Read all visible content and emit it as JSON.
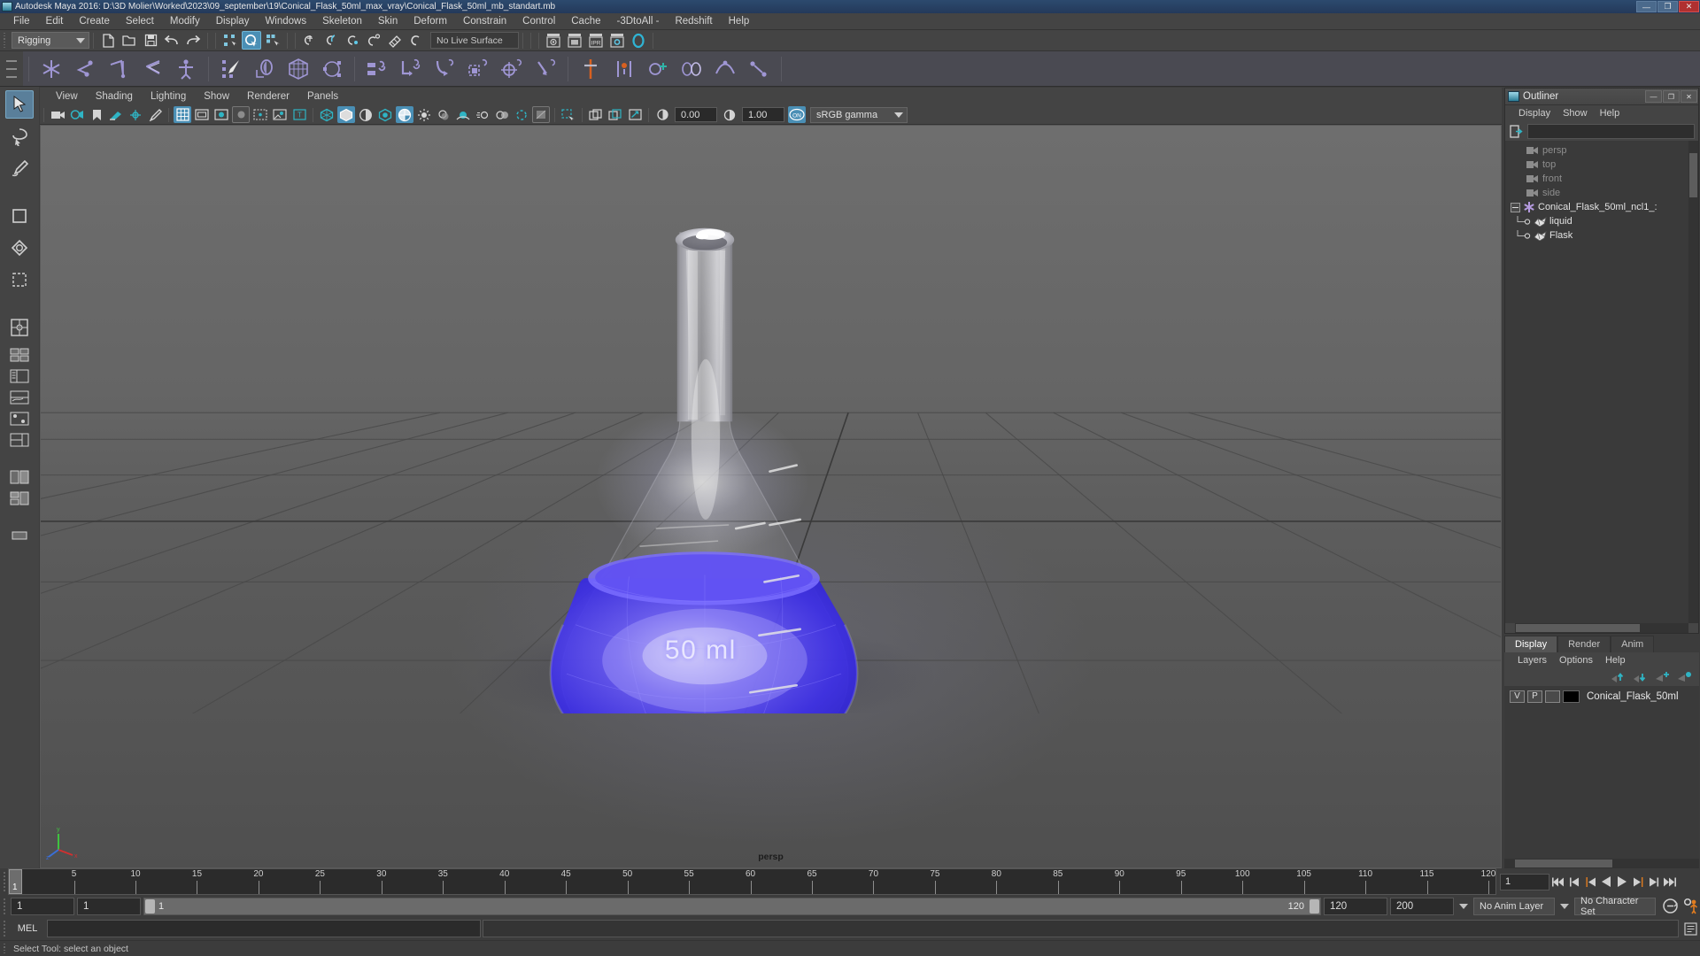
{
  "window": {
    "title": "Autodesk Maya 2016: D:\\3D Molier\\Worked\\2023\\09_september\\19\\Conical_Flask_50ml_max_vray\\Conical_Flask_50ml_mb_standart.mb",
    "minimize": "—",
    "maximize": "❐",
    "close": "✕",
    "icon": "maya-app-icon"
  },
  "menubar": {
    "items": [
      {
        "label": "File"
      },
      {
        "label": "Edit"
      },
      {
        "label": "Create"
      },
      {
        "label": "Select"
      },
      {
        "label": "Modify"
      },
      {
        "label": "Display"
      },
      {
        "label": "Windows"
      },
      {
        "label": "Skeleton"
      },
      {
        "label": "Skin"
      },
      {
        "label": "Deform"
      },
      {
        "label": "Constrain"
      },
      {
        "label": "Control"
      },
      {
        "label": "Cache"
      },
      {
        "label": "-3DtoAll -"
      },
      {
        "label": "Redshift"
      },
      {
        "label": "Help"
      }
    ]
  },
  "statusline": {
    "menuset": "Rigging",
    "live_surface": "No Live Surface",
    "icons": [
      "new-scene-icon",
      "open-scene-icon",
      "save-scene-icon",
      "undo-icon",
      "redo-icon",
      "select-by-hierarchy-icon",
      "select-by-object-icon",
      "select-by-component-icon",
      "snap-to-grid-icon",
      "snap-to-curve-icon",
      "snap-to-point-icon",
      "snap-to-projected-center-icon",
      "snap-to-view-plane-icon",
      "make-live-icon",
      "render-current-frame-icon",
      "irender-region-icon",
      "ipr-render-icon",
      "render-settings-icon",
      "hypershade-icon"
    ]
  },
  "shelf": {
    "tab": "Rigging",
    "icons": [
      "create-joint-icon",
      "insert-joint-icon",
      "mirror-joint-icon",
      "ik-handle-icon",
      "quick-rig-icon",
      "paint-skin-weights-icon",
      "bind-skin-icon",
      "lattice-deformer-icon",
      "cluster-deformer-icon",
      "parent-constraint-icon",
      "point-constraint-icon",
      "orient-constraint-icon",
      "scale-constraint-icon",
      "aim-constraint-icon",
      "pole-vector-constraint-icon",
      "set-driven-key-icon",
      "character-set-icon",
      "add-to-character-set-icon",
      "blend-shape-icon",
      "create-deformer-icon",
      "connect-joint-icon"
    ]
  },
  "toolbox": {
    "tools": [
      {
        "name": "select-tool",
        "active": true
      },
      {
        "name": "lasso-select-tool",
        "active": false
      },
      {
        "name": "paint-select-tool",
        "active": false
      },
      {
        "name": "move-tool",
        "active": false
      },
      {
        "name": "rotate-tool",
        "active": false
      },
      {
        "name": "scale-tool",
        "active": false
      }
    ],
    "layouts": [
      "single-perspective-layout",
      "four-view-layout",
      "outliner-persp-layout",
      "persp-graph-layout",
      "hypershade-persp-layout",
      "persp-outliner-layout",
      "two-pane-side-layout",
      "three-pane-split-layout",
      "last-layout"
    ]
  },
  "viewport": {
    "menu": [
      {
        "label": "View"
      },
      {
        "label": "Shading"
      },
      {
        "label": "Lighting"
      },
      {
        "label": "Show"
      },
      {
        "label": "Renderer"
      },
      {
        "label": "Panels"
      }
    ],
    "toolbar_icons": [
      "select-camera-icon",
      "camera-attributes-icon",
      "bookmark-icon",
      "image-plane-icon",
      "2d-pan-zoom-icon",
      "grease-pencil-icon",
      "grid-toggle-icon",
      "film-gate-icon",
      "resolution-gate-icon",
      "gate-mask-icon",
      "film-origin-icon",
      "exposure-icon",
      "xray-icon",
      "wireframe-shading-icon",
      "smooth-shading-icon",
      "smooth-shade-all-icon",
      "shaded-wireframe-icon",
      "textured-icon",
      "lighting-icon",
      "shadows-icon",
      "screen-space-ao-icon",
      "motion-blur-icon",
      "multisample-icon",
      "isolate-select-icon",
      "xray-joints-icon",
      "xray-active-components-icon",
      "exposure-reset-icon"
    ],
    "exposure": "0.00",
    "gamma": "1.00",
    "color_management_on": "ON",
    "view_transform": "sRGB gamma",
    "camera_label": "persp",
    "object_label": "50 ml"
  },
  "outliner": {
    "title": "Outliner",
    "icon": "outliner-window-icon",
    "menu": [
      {
        "label": "Display"
      },
      {
        "label": "Show"
      },
      {
        "label": "Help"
      }
    ],
    "search_placeholder": "",
    "search_value": "",
    "items": [
      {
        "label": "persp",
        "type": "camera",
        "dim": true,
        "indent": 1
      },
      {
        "label": "top",
        "type": "camera",
        "dim": true,
        "indent": 1
      },
      {
        "label": "front",
        "type": "camera",
        "dim": true,
        "indent": 1
      },
      {
        "label": "side",
        "type": "camera",
        "dim": true,
        "indent": 1
      },
      {
        "label": "Conical_Flask_50ml_ncl1_:",
        "type": "group",
        "dim": false,
        "indent": 0
      },
      {
        "label": "liquid",
        "type": "mesh",
        "dim": false,
        "indent": 2
      },
      {
        "label": "Flask",
        "type": "mesh",
        "dim": false,
        "indent": 2
      }
    ]
  },
  "layer_editor": {
    "tabs": [
      {
        "label": "Display",
        "active": true
      },
      {
        "label": "Render",
        "active": false
      },
      {
        "label": "Anim",
        "active": false
      }
    ],
    "menu": [
      {
        "label": "Layers"
      },
      {
        "label": "Options"
      },
      {
        "label": "Help"
      }
    ],
    "buttons": [
      "move-layer-up-icon",
      "move-layer-down-icon",
      "new-layer-icon",
      "new-layer-from-selected-icon"
    ],
    "layers": [
      {
        "visibility": "V",
        "playback": "P",
        "state": "",
        "color": "#000000",
        "name": "Conical_Flask_50ml"
      }
    ]
  },
  "timeline": {
    "start": 1,
    "end": 120,
    "current": "1",
    "tick_labels": [
      "5",
      "10",
      "15",
      "20",
      "25",
      "30",
      "35",
      "40",
      "45",
      "50",
      "55",
      "60",
      "65",
      "70",
      "75",
      "80",
      "85",
      "90",
      "95",
      "100",
      "105",
      "110",
      "115",
      "120"
    ],
    "playback_buttons": [
      "go-to-start-icon",
      "step-back-keyframe-icon",
      "step-back-frame-icon",
      "play-backwards-icon",
      "play-forwards-icon",
      "step-forward-frame-icon",
      "step-forward-keyframe-icon",
      "go-to-end-icon"
    ]
  },
  "rangeslider": {
    "anim_start": "1",
    "playback_start": "1",
    "bar_start_label": "1",
    "bar_end_label": "120",
    "playback_end": "120",
    "anim_end": "200",
    "anim_layer": "No Anim Layer",
    "character_set": "No Character Set",
    "icons": [
      "auto-keyframe-icon",
      "animation-preferences-icon"
    ]
  },
  "commandline": {
    "language": "MEL",
    "input_value": "",
    "input_placeholder": "",
    "output_value": "",
    "script_editor_icon": "script-editor-icon"
  },
  "helpline": {
    "message": "Select Tool: select an object"
  },
  "colors": {
    "accent": "#4a8fb5",
    "liquid": "#3b31e8",
    "shelf_icon": "#9f96d4",
    "title_bar": "#2c4a6e",
    "panel_bg": "#444444"
  }
}
